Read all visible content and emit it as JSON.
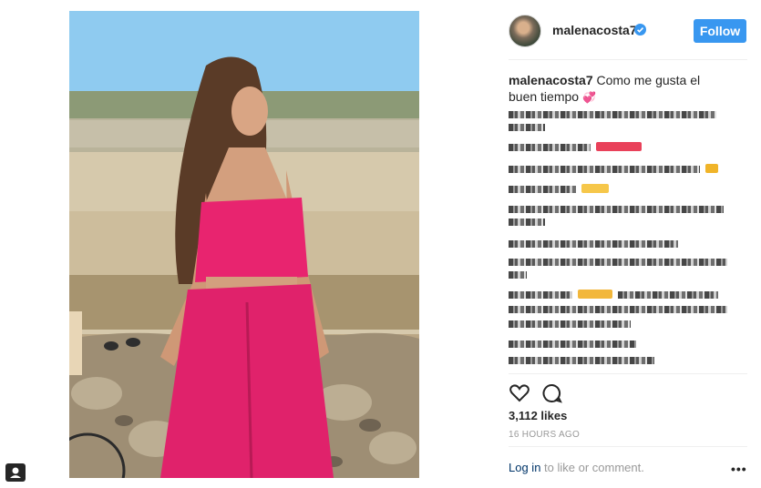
{
  "post": {
    "username": "malenacosta7",
    "follow_label": "Follow",
    "caption_user": "malenacosta7",
    "caption_text": "Como me gusta el buen tiempo",
    "likes": "3,112 likes",
    "timestamp": "16 HOURS AGO",
    "login_link": "Log in",
    "login_suffix": " to like or comment.",
    "more": "•••"
  },
  "icons": {
    "verified": "verified-badge-icon",
    "like": "heart-outline-icon",
    "comment": "speech-bubble-icon",
    "more": "more-options-icon",
    "corner": "person-tag-icon"
  },
  "colors": {
    "accent": "#3897f0",
    "dress": "#e8246f",
    "link": "#003569"
  }
}
